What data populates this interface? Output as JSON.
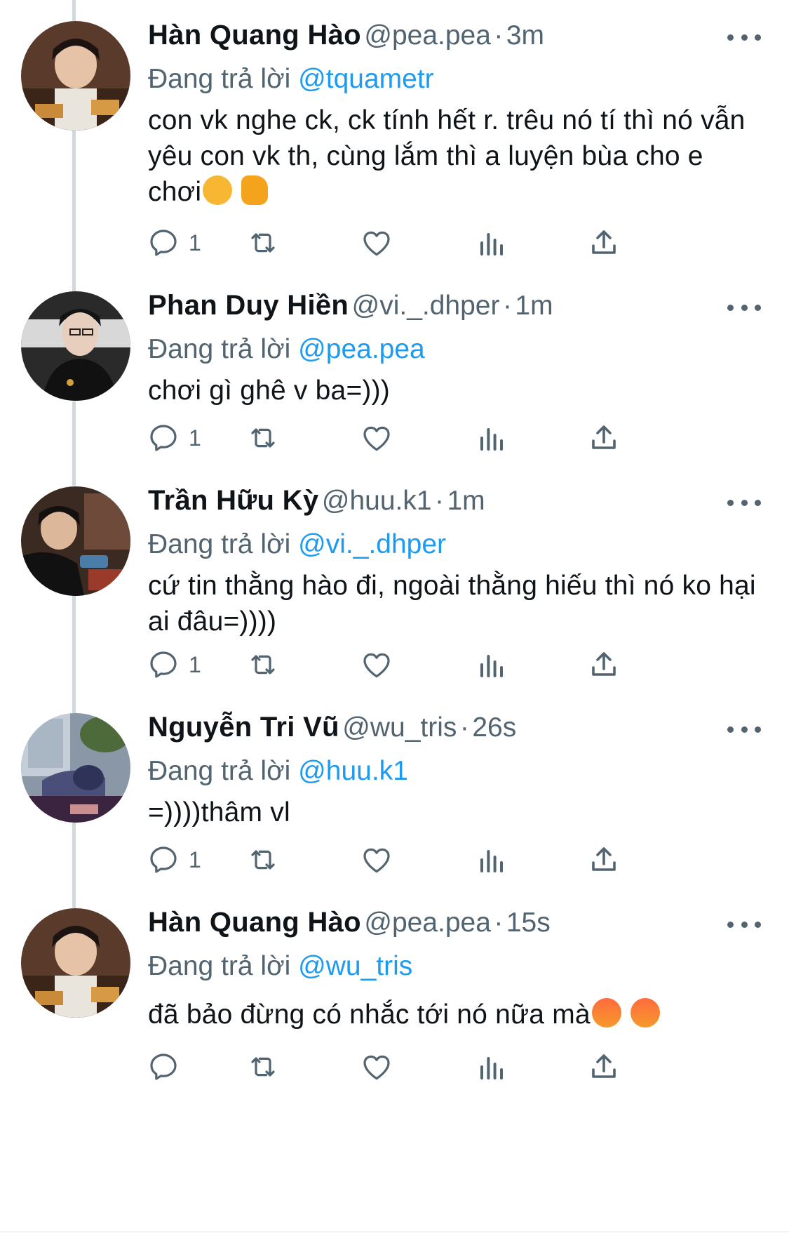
{
  "tweets": [
    {
      "name": "Hàn Quang Hào",
      "handle": "@pea.pea",
      "time": "3m",
      "reply_prefix": "Đang trả lời",
      "reply_to": "@tquametr",
      "text": "con vk nghe ck, ck tính hết r. trêu nó tí thì nó vẫn yêu con vk th, cùng lắm thì a luyện bùa cho e chơi",
      "emojis": [
        "smirking-face",
        "fist"
      ],
      "reply_count": "1"
    },
    {
      "name": "Phan Duy Hiền",
      "handle": "@vi._.dhper",
      "time": "1m",
      "reply_prefix": "Đang trả lời",
      "reply_to": "@pea.pea",
      "text": "chơi gì ghê v ba=)))",
      "reply_count": "1"
    },
    {
      "name": "Trần Hữu Kỳ",
      "handle": "@huu.k1",
      "time": "1m",
      "reply_prefix": "Đang trả lời",
      "reply_to": "@vi._.dhper",
      "text": "cứ tin thằng hào đi, ngoài thằng hiếu thì nó ko hại ai đâu=))))",
      "reply_count": "1"
    },
    {
      "name": "Nguyễn Tri Vũ",
      "handle": "@wu_tris",
      "time": "26s",
      "reply_prefix": "Đang trả lời",
      "reply_to": "@huu.k1",
      "text": "=))))thâm vl",
      "reply_count": "1"
    },
    {
      "name": "Hàn Quang Hào",
      "handle": "@pea.pea",
      "time": "15s",
      "reply_prefix": "Đang trả lời",
      "reply_to": "@wu_tris",
      "text": "đã bảo đừng có nhắc tới nó nữa mà",
      "emojis": [
        "angry-face",
        "angry-face"
      ],
      "reply_count": ""
    }
  ],
  "separator": "·",
  "icons": [
    "reply-icon",
    "retweet-icon",
    "like-icon",
    "analytics-icon",
    "share-icon",
    "more-icon"
  ],
  "colors": {
    "accent": "#1d9bf0",
    "muted": "#536471",
    "thread_line": "#cfd9de",
    "text": "#0f1419"
  }
}
